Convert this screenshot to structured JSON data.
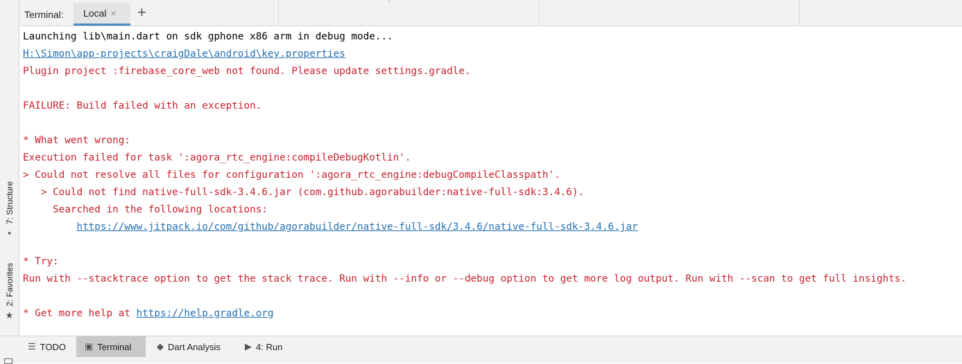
{
  "header": {
    "title": "Terminal:",
    "tab_label": "Local",
    "close_glyph": "×",
    "add_glyph": "+"
  },
  "left_stripe": {
    "structure_label": "7: Structure",
    "favorites_label": "2: Favorites",
    "structure_icon": "structure-icon",
    "favorites_icon": "star-icon"
  },
  "terminal": {
    "lines": [
      {
        "text": "Launching lib\\main.dart on sdk gphone x86 arm in debug mode...",
        "style": "black"
      },
      {
        "text": "H:\\Simon\\app-projects\\craigDale\\android\\key.properties",
        "style": "link"
      },
      {
        "text": "Plugin project :firebase_core_web not found. Please update settings.gradle.",
        "style": "red"
      },
      {
        "text": "",
        "style": "red"
      },
      {
        "text": "FAILURE: Build failed with an exception.",
        "style": "red"
      },
      {
        "text": "",
        "style": "red"
      },
      {
        "text": "* What went wrong:",
        "style": "red"
      },
      {
        "text": "Execution failed for task ':agora_rtc_engine:compileDebugKotlin'.",
        "style": "red"
      },
      {
        "text": "> Could not resolve all files for configuration ':agora_rtc_engine:debugCompileClasspath'.",
        "style": "red"
      },
      {
        "text": "   > Could not find native-full-sdk-3.4.6.jar (com.github.agorabuilder:native-full-sdk:3.4.6).",
        "style": "red"
      },
      {
        "text": "     Searched in the following locations:",
        "style": "red"
      },
      {
        "text": "https://www.jitpack.io/com/github/agorabuilder/native-full-sdk/3.4.6/native-full-sdk-3.4.6.jar",
        "style": "link",
        "indent": "         "
      },
      {
        "text": "",
        "style": "red"
      },
      {
        "text": "* Try:",
        "style": "red"
      },
      {
        "text": "Run with --stacktrace option to get the stack trace. Run with --info or --debug option to get more log output. Run with --scan to get full insights.",
        "style": "red"
      },
      {
        "text": "",
        "style": "red"
      },
      {
        "text": "* Get more help at ",
        "style": "red",
        "link": "https://help.gradle.org"
      }
    ]
  },
  "bottom_bar": {
    "todo": "TODO",
    "terminal": "Terminal",
    "dart": "Dart Analysis",
    "run": "4: Run",
    "icons": {
      "todo": "list-icon",
      "terminal": "terminal-icon",
      "dart": "dart-analysis-icon",
      "run": "run-icon"
    }
  }
}
